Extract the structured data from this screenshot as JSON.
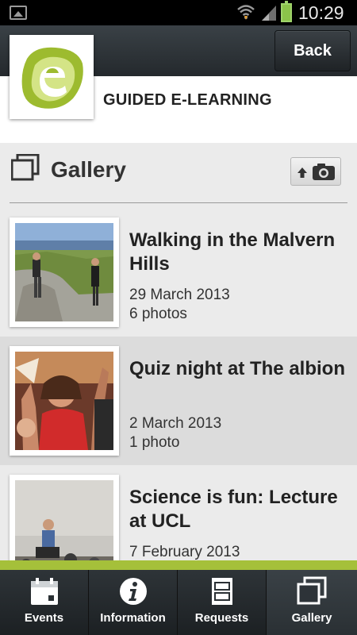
{
  "status_bar": {
    "time": "10:29"
  },
  "action_bar": {
    "back_label": "Back"
  },
  "header": {
    "title": "GUIDED E-LEARNING",
    "logo_icon": "elearning-logo"
  },
  "gallery": {
    "title": "Gallery",
    "upload_icon": "upload-photo-icon"
  },
  "albums": [
    {
      "title": "Walking in the Malvern Hills",
      "date": "29 March 2013",
      "count": "6 photos"
    },
    {
      "title": "Quiz night at The albion",
      "date": "2 March 2013",
      "count": "1 photo"
    },
    {
      "title": "Science is fun: Lecture at UCL",
      "date": "7 February 2013",
      "count": ""
    }
  ],
  "tabs": [
    {
      "label": "Events",
      "icon": "calendar-icon"
    },
    {
      "label": "Information",
      "icon": "info-icon"
    },
    {
      "label": "Requests",
      "icon": "form-icon"
    },
    {
      "label": "Gallery",
      "icon": "gallery-icon"
    }
  ],
  "colors": {
    "accent": "#a5c03a",
    "logo_green": "#9dbb2f",
    "bar_dark": "#2a3034"
  }
}
